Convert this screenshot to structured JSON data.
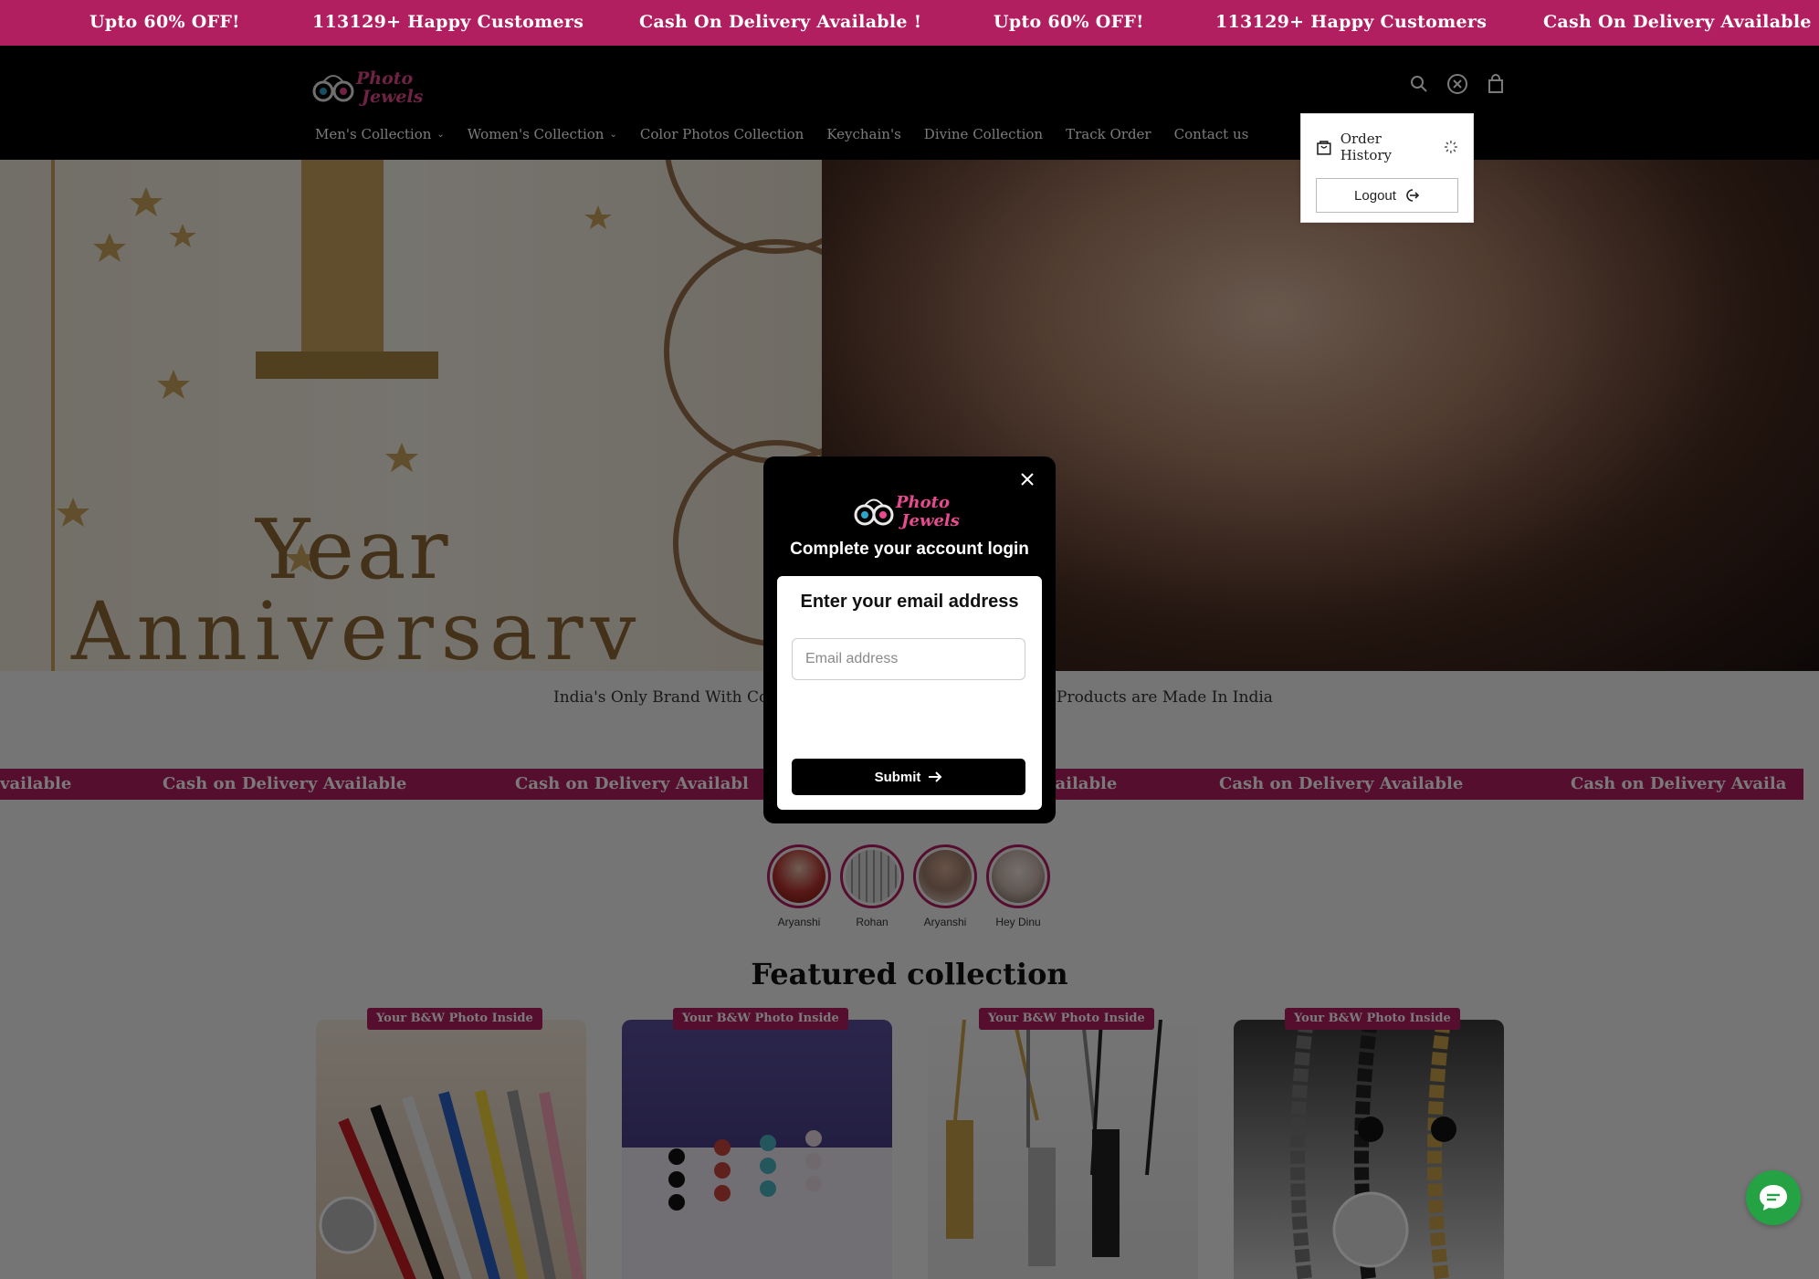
{
  "announcement": {
    "items": [
      "Upto 60% OFF!",
      "113129+ Happy Customers",
      "Cash On Delivery Available !",
      "Upto 60% OFF!",
      "113129+ Happy Customers",
      "Cash On Delivery Available !"
    ]
  },
  "header": {
    "logo_text_line1": "Photo",
    "logo_text_line2": "Jewels",
    "icons": [
      "search-icon",
      "account-icon",
      "cart-icon"
    ]
  },
  "nav": {
    "items": [
      {
        "label": "Men's Collection",
        "has_dropdown": true
      },
      {
        "label": "Women's Collection",
        "has_dropdown": true
      },
      {
        "label": "Color Photos Collection",
        "has_dropdown": false
      },
      {
        "label": "Keychain's",
        "has_dropdown": false
      },
      {
        "label": "Divine Collection",
        "has_dropdown": false
      },
      {
        "label": "Track Order",
        "has_dropdown": false
      },
      {
        "label": "Contact us",
        "has_dropdown": false
      }
    ]
  },
  "account_menu": {
    "order_history": "Order History",
    "logout": "Logout"
  },
  "hero": {
    "year": "Year",
    "anniversary": "Anniversarv"
  },
  "tagline": {
    "left": "India's Only Brand With Co",
    "right": "Products are Made In India"
  },
  "cod_bar": {
    "items": [
      "vailable",
      "Cash on Delivery Available",
      "Cash on Delivery Availabl",
      "vailable",
      "Cash on Delivery Available",
      "Cash on Delivery Availa"
    ]
  },
  "stories": [
    {
      "name": "Aryanshi"
    },
    {
      "name": "Rohan"
    },
    {
      "name": "Aryanshi"
    },
    {
      "name": "Hey Dinu"
    }
  ],
  "featured": {
    "title": "Featured collection",
    "products": [
      {
        "badge": "Your B&W Photo Inside"
      },
      {
        "badge": "Your B&W Photo Inside"
      },
      {
        "badge": "Your B&W Photo Inside"
      },
      {
        "badge": "Your B&W Photo Inside"
      }
    ]
  },
  "modal": {
    "title": "Complete your account login",
    "card_title": "Enter your email address",
    "email_placeholder": "Email address",
    "submit_label": "Submit"
  },
  "colors": {
    "brand": "#b21f61",
    "header_bg": "#000000",
    "chat_green": "#25a244"
  }
}
